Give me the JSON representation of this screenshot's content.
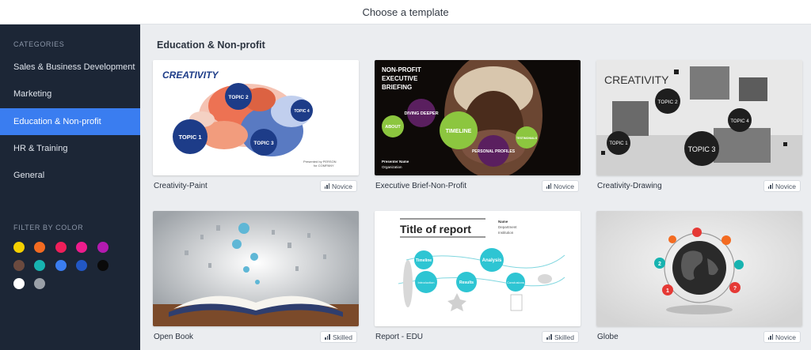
{
  "header": {
    "title": "Choose a template"
  },
  "sidebar": {
    "categories_heading": "CATEGORIES",
    "categories": [
      {
        "label": "Sales & Business Development",
        "active": false
      },
      {
        "label": "Marketing",
        "active": false
      },
      {
        "label": "Education & Non-profit",
        "active": true
      },
      {
        "label": "HR & Training",
        "active": false
      },
      {
        "label": "General",
        "active": false
      }
    ],
    "filter_heading": "FILTER BY COLOR",
    "colors": [
      "#f5d000",
      "#f36b21",
      "#ef1f5a",
      "#ed1c8c",
      "#b31ab0",
      "#6b4a3f",
      "#17b3b0",
      "#3a7df0",
      "#2257c4",
      "#0a0a0a",
      "#ffffff",
      "#9aa0a8"
    ],
    "accent_color": "#3a7df0"
  },
  "main": {
    "section_title": "Education & Non-profit",
    "templates": [
      {
        "name": "Creativity-Paint",
        "level": "Novice",
        "thumb": {
          "heading": "CREATIVITY",
          "topics": [
            "TOPIC 1",
            "TOPIC 2",
            "TOPIC 3",
            "TOPIC 4"
          ],
          "footer": [
            "Presented by PERSON",
            "for COMPANY"
          ]
        }
      },
      {
        "name": "Executive Brief-Non-Profit",
        "level": "Novice",
        "thumb": {
          "heading": [
            "NON-PROFIT",
            "EXECUTIVE",
            "BRIEFING"
          ],
          "bubbles": [
            "ABOUT",
            "DIVING DEEPER",
            "TIMELINE",
            "TESTIMONIALS",
            "PERSONAL PROFILES"
          ],
          "presenter": [
            "Presenter Name",
            "Organization"
          ]
        }
      },
      {
        "name": "Creativity-Drawing",
        "level": "Novice",
        "thumb": {
          "heading": "CREATIVITY",
          "topics": [
            "TOPIC 1",
            "TOPIC 2",
            "TOPIC 3",
            "TOPIC 4"
          ]
        }
      },
      {
        "name": "Open Book",
        "level": "Skilled",
        "thumb": {}
      },
      {
        "name": "Report - EDU",
        "level": "Skilled",
        "thumb": {
          "heading": "Title of report",
          "side": [
            "Name",
            "Department",
            "Institution"
          ],
          "bubbles": [
            "Timeline",
            "Analysis",
            "Introduction",
            "Results",
            "Conclusions"
          ]
        }
      },
      {
        "name": "Globe",
        "level": "Novice",
        "thumb": {
          "markers": [
            "1",
            "2",
            "?"
          ]
        }
      }
    ]
  }
}
